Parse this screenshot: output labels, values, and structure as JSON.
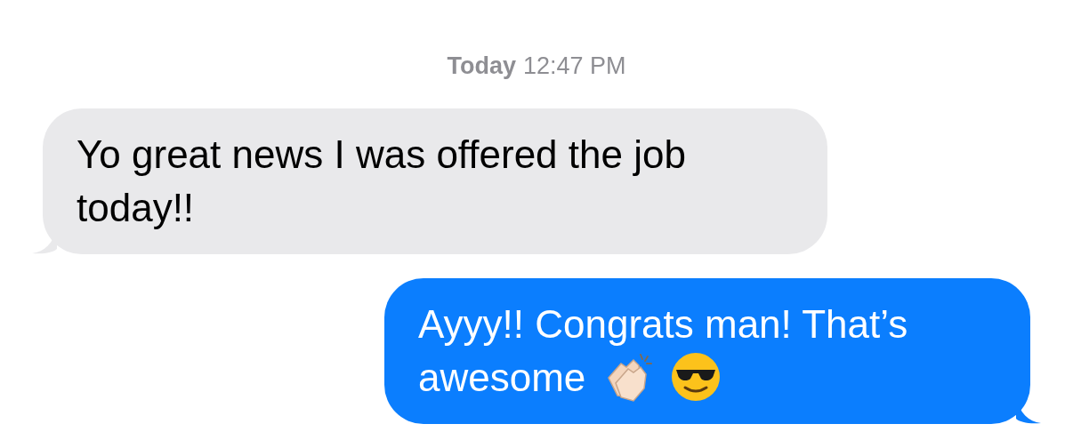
{
  "timestamp": {
    "day": "Today",
    "time": "12:47 PM"
  },
  "messages": [
    {
      "kind": "received",
      "text": "Yo great news I was offered the job today!!"
    },
    {
      "kind": "sent",
      "text": "Ayyy!! Congrats man! That’s awesome",
      "emoji": [
        {
          "kind": "clap"
        },
        {
          "kind": "cool"
        }
      ]
    }
  ]
}
